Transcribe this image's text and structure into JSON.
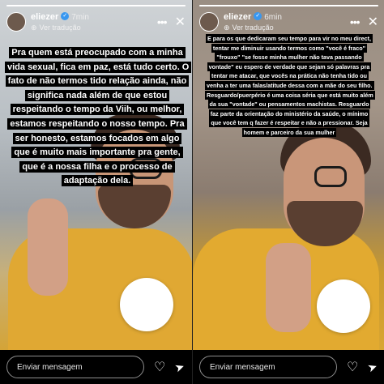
{
  "stories": [
    {
      "username": "eliezer",
      "time": "7min",
      "translate_label": "Ver tradução",
      "progress": 1.0,
      "caption": "Pra quem está preocupado com a minha vida sexual, fica em paz, está tudo certo. O fato de não termos tido relação ainda, não significa nada além de que estou respeitando o tempo da Viih, ou melhor, estamos respeitando o nosso tempo. Pra ser honesto, estamos focados em algo que é muito mais importante pra gente, que é a nossa filha e o processo de adaptação dela.",
      "sticker_emoji": "😍",
      "message_placeholder": "Enviar mensagem"
    },
    {
      "username": "eliezer",
      "time": "6min",
      "translate_label": "Ver tradução",
      "progress": 1.0,
      "caption": "E para os que dedicaram seu tempo para vir no meu direct, tentar me diminuir usando termos como \"você é fraco\" \"frouxo\" \"se fosse minha mulher não tava passando vontade\" eu espero de verdade que sejam só palavras pra tentar me atacar, que vocês na prática não tenha tido ou venha a ter uma falas/atitude dessa com a mãe do seu filho. Resguardo/puerpério é uma coisa séria que está muito além da sua \"vontade\" ou pensamentos machistas. Resguardo faz parte da orientação do ministério da saúde, o mínimo que você tem q fazer é respeitar e não a pressionar. Seja homem e parceiro da sua mulher",
      "sticker_emoji": "😍",
      "message_placeholder": "Enviar mensagem"
    }
  ],
  "icons": {
    "verified": "verified-badge-icon",
    "globe": "globe-icon",
    "more": "more-options-icon",
    "close": "close-icon",
    "like": "heart-icon",
    "share": "send-icon"
  },
  "colors": {
    "verified_blue": "#3897f0",
    "shirt_yellow": "#e0a833"
  }
}
